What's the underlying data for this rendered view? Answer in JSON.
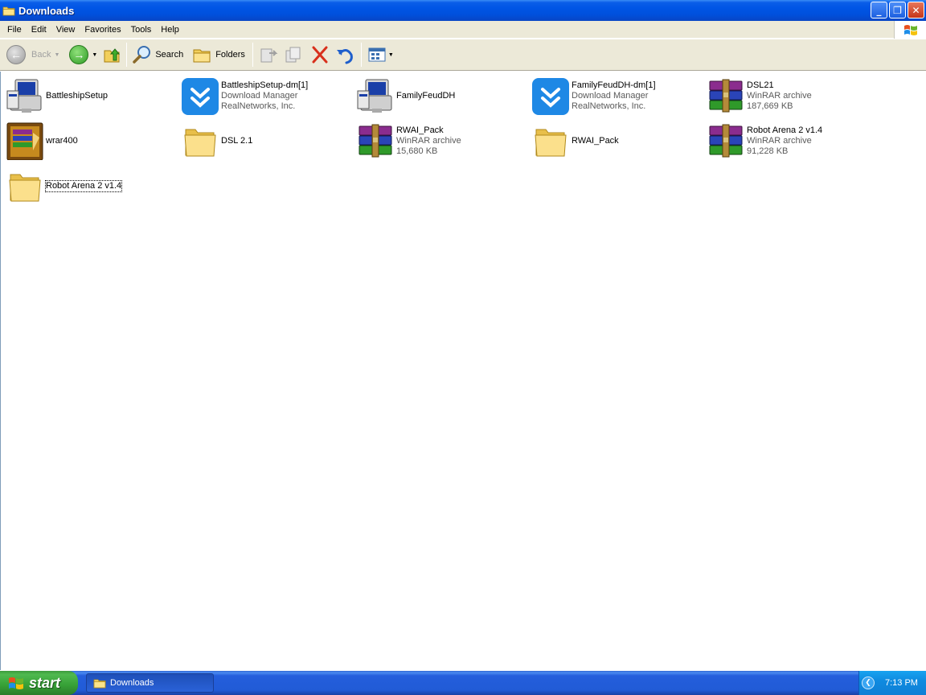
{
  "window": {
    "title": "Downloads",
    "buttons": {
      "minimize": "_",
      "maximize": "❐",
      "close": "✕"
    }
  },
  "menubar": {
    "items": [
      {
        "label": "File"
      },
      {
        "label": "Edit"
      },
      {
        "label": "View"
      },
      {
        "label": "Favorites"
      },
      {
        "label": "Tools"
      },
      {
        "label": "Help"
      }
    ]
  },
  "toolbar": {
    "back_label": "Back",
    "search_label": "Search",
    "folders_label": "Folders"
  },
  "files": [
    {
      "name": "BattleshipSetup",
      "icon": "installer-icon",
      "meta1": "",
      "meta2": ""
    },
    {
      "name": "BattleshipSetup-dm[1]",
      "icon": "download-manager-icon",
      "meta1": "Download Manager",
      "meta2": "RealNetworks, Inc."
    },
    {
      "name": "FamilyFeudDH",
      "icon": "installer-icon",
      "meta1": "",
      "meta2": ""
    },
    {
      "name": "FamilyFeudDH-dm[1]",
      "icon": "download-manager-icon",
      "meta1": "Download Manager",
      "meta2": "RealNetworks, Inc."
    },
    {
      "name": "DSL21",
      "icon": "winrar-archive-icon",
      "meta1": "WinRAR archive",
      "meta2": "187,669 KB"
    },
    {
      "name": "wrar400",
      "icon": "winrar-installer-icon",
      "meta1": "",
      "meta2": ""
    },
    {
      "name": "DSL 2.1",
      "icon": "folder-icon",
      "meta1": "",
      "meta2": ""
    },
    {
      "name": "RWAI_Pack",
      "icon": "winrar-archive-icon",
      "meta1": "WinRAR archive",
      "meta2": "15,680 KB"
    },
    {
      "name": "RWAI_Pack",
      "icon": "folder-icon",
      "meta1": "",
      "meta2": ""
    },
    {
      "name": "Robot Arena 2 v1.4",
      "icon": "winrar-archive-icon",
      "meta1": "WinRAR archive",
      "meta2": "91,228 KB"
    },
    {
      "name": "Robot Arena 2 v1.4",
      "icon": "folder-icon",
      "meta1": "",
      "meta2": ""
    }
  ],
  "taskbar": {
    "start_label": "start",
    "task_label": "Downloads",
    "clock": "7:13 PM"
  },
  "colors": {
    "titlebar": "#0055e5",
    "chrome": "#ece9d8",
    "taskbar": "#245edc",
    "start": "#36a036"
  }
}
